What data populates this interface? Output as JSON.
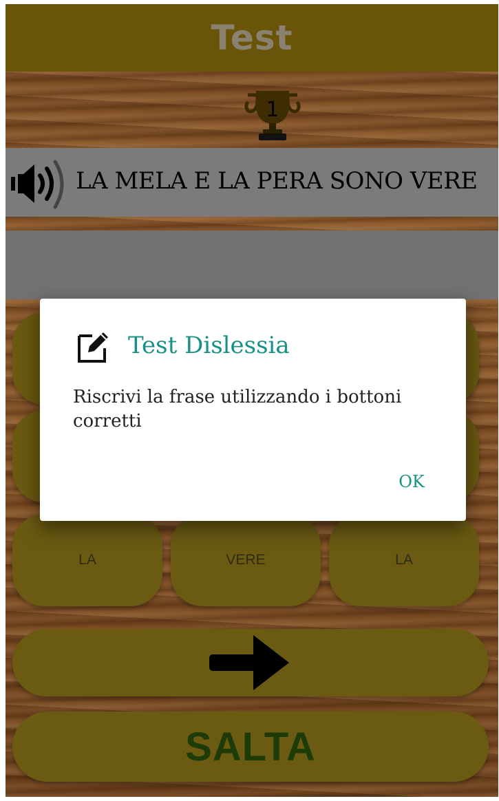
{
  "header": {
    "title": "Test"
  },
  "score": {
    "value": "1",
    "icon": "trophy-icon"
  },
  "sentence": {
    "text": "LA MELA E LA PERA SONO VERE",
    "audio_icon": "speaker-icon"
  },
  "answer": {
    "text": ""
  },
  "word_buttons": [
    {
      "label": ""
    },
    {
      "label": ""
    },
    {
      "label": ""
    },
    {
      "label": ""
    },
    {
      "label": ""
    },
    {
      "label": ""
    },
    {
      "label": "LA"
    },
    {
      "label": "VERE"
    },
    {
      "label": "LA"
    }
  ],
  "actions": {
    "next_icon": "arrow-right-icon",
    "skip_label": "SALTA"
  },
  "dialog": {
    "icon": "edit-icon",
    "title": "Test Dislessia",
    "message": "Riscrivi la frase utilizzando i bottoni corretti",
    "ok_label": "OK"
  },
  "colors": {
    "header_bg": "#6a5409",
    "button_yellow_dimmed": "#6a5a12",
    "dialog_accent": "#159185",
    "skip_text": "#1d3b06"
  }
}
